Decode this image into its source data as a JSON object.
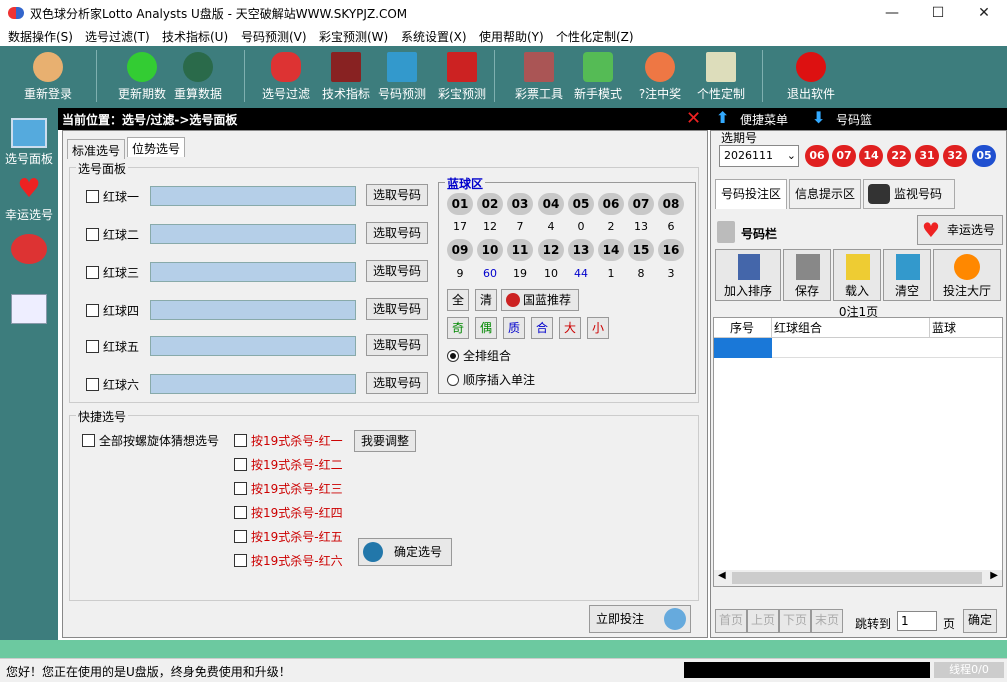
{
  "window": {
    "title": "双色球分析家Lotto Analysts U盘版 - 天空破解站WWW.SKYPJZ.COM",
    "min": "—",
    "max": "☐",
    "close": "✕"
  },
  "menu": [
    "数据操作(S)",
    "选号过滤(T)",
    "技术指标(U)",
    "号码预测(V)",
    "彩宝预测(W)",
    "系统设置(X)",
    "使用帮助(Y)",
    "个性化定制(Z)"
  ],
  "toolbar": [
    "重新登录",
    "更新期数",
    "重算数据",
    "选号过滤",
    "技术指标",
    "号码预测",
    "彩宝预测",
    "彩票工具",
    "新手模式",
    "?注中奖",
    "个性定制",
    "退出软件"
  ],
  "leftbar": [
    "选号面板",
    "幸运选号"
  ],
  "crumb": "当前位置：选号/过滤->选号面板",
  "quick": {
    "menu": "便捷菜单",
    "basket": "号码篮"
  },
  "tabs": {
    "standard": "标准选号",
    "position": "位势选号"
  },
  "panel": {
    "title": "选号面板",
    "reds": [
      "红球一",
      "红球二",
      "红球三",
      "红球四",
      "红球五",
      "红球六"
    ],
    "pick": "选取号码",
    "blue_title": "蓝球区",
    "blue_rows": [
      {
        "balls": [
          "01",
          "02",
          "03",
          "04",
          "05",
          "06",
          "07",
          "08"
        ],
        "nums": [
          "17",
          "12",
          "7",
          "4",
          "0",
          "2",
          "13",
          "6"
        ]
      },
      {
        "balls": [
          "09",
          "10",
          "11",
          "12",
          "13",
          "14",
          "15",
          "16"
        ],
        "nums": [
          "9",
          "60",
          "19",
          "10",
          "44",
          "1",
          "8",
          "3"
        ]
      }
    ],
    "blue_btns": [
      "全",
      "清",
      "国蓝推荐"
    ],
    "attr_btns": [
      "奇",
      "偶",
      "质",
      "合",
      "大",
      "小"
    ],
    "radios": [
      "全排组合",
      "顺序插入单注"
    ]
  },
  "fast": {
    "title": "快捷选号",
    "spiral": "全部按螺旋体猜想选号",
    "kills": [
      "按19式杀号-红一",
      "按19式杀号-红二",
      "按19式杀号-红三",
      "按19式杀号-红四",
      "按19式杀号-红五",
      "按19式杀号-红六"
    ],
    "adjust": "我要调整",
    "confirm": "确定选号",
    "bet_now": "立即投注"
  },
  "right": {
    "period_label": "选期号",
    "period": "2026111",
    "balls": [
      "06",
      "07",
      "14",
      "22",
      "31",
      "32",
      "05"
    ],
    "tabs": [
      "号码投注区",
      "信息提示区",
      "监视号码"
    ],
    "basket_title": "号码栏",
    "lucky": "幸运选号",
    "actions": [
      "加入排序",
      "保存",
      "载入",
      "清空",
      "投注大厅"
    ],
    "count": "0注1页",
    "cols": [
      "序号",
      "红球组合",
      "蓝球"
    ],
    "pager": [
      "首页",
      "上页",
      "下页",
      "末页"
    ],
    "jump": "跳转到",
    "page": "1",
    "page_unit": "页",
    "ok": "确定"
  },
  "status": {
    "msg": "您好！您正在使用的是U盘版，终身免费使用和升级！",
    "progress": "线程0/0"
  }
}
